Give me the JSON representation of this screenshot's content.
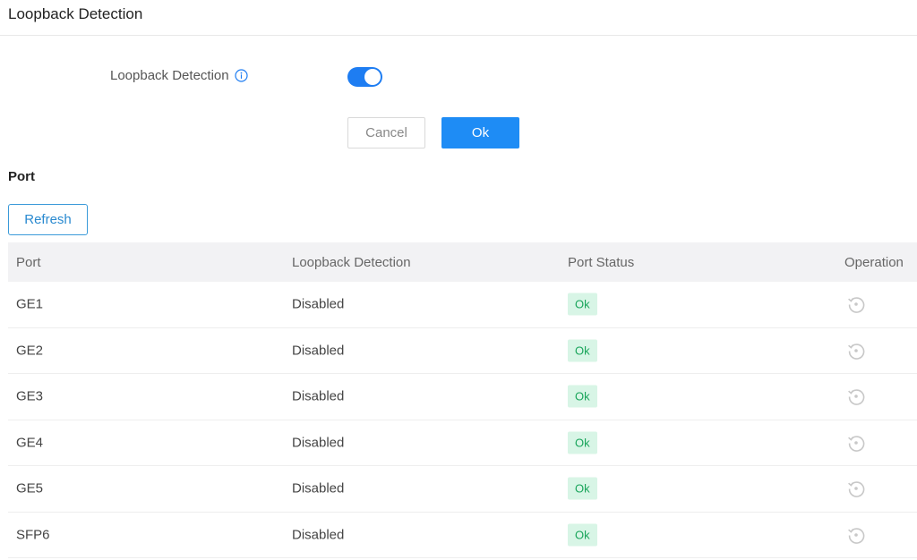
{
  "header": {
    "title": "Loopback Detection"
  },
  "settings": {
    "label": "Loopback Detection",
    "info_icon": "info-icon",
    "toggle_on": true,
    "accent_color": "#1e7df2",
    "cancel_label": "Cancel",
    "ok_label": "Ok"
  },
  "port_section": {
    "title": "Port",
    "refresh_label": "Refresh",
    "columns": [
      "Port",
      "Loopback Detection",
      "Port Status",
      "Operation"
    ],
    "rows": [
      {
        "port": "GE1",
        "loopback": "Disabled",
        "status": "Ok",
        "operation_icon": "reset-icon"
      },
      {
        "port": "GE2",
        "loopback": "Disabled",
        "status": "Ok",
        "operation_icon": "reset-icon"
      },
      {
        "port": "GE3",
        "loopback": "Disabled",
        "status": "Ok",
        "operation_icon": "reset-icon"
      },
      {
        "port": "GE4",
        "loopback": "Disabled",
        "status": "Ok",
        "operation_icon": "reset-icon"
      },
      {
        "port": "GE5",
        "loopback": "Disabled",
        "status": "Ok",
        "operation_icon": "reset-icon"
      },
      {
        "port": "SFP6",
        "loopback": "Disabled",
        "status": "Ok",
        "operation_icon": "reset-icon"
      }
    ]
  }
}
